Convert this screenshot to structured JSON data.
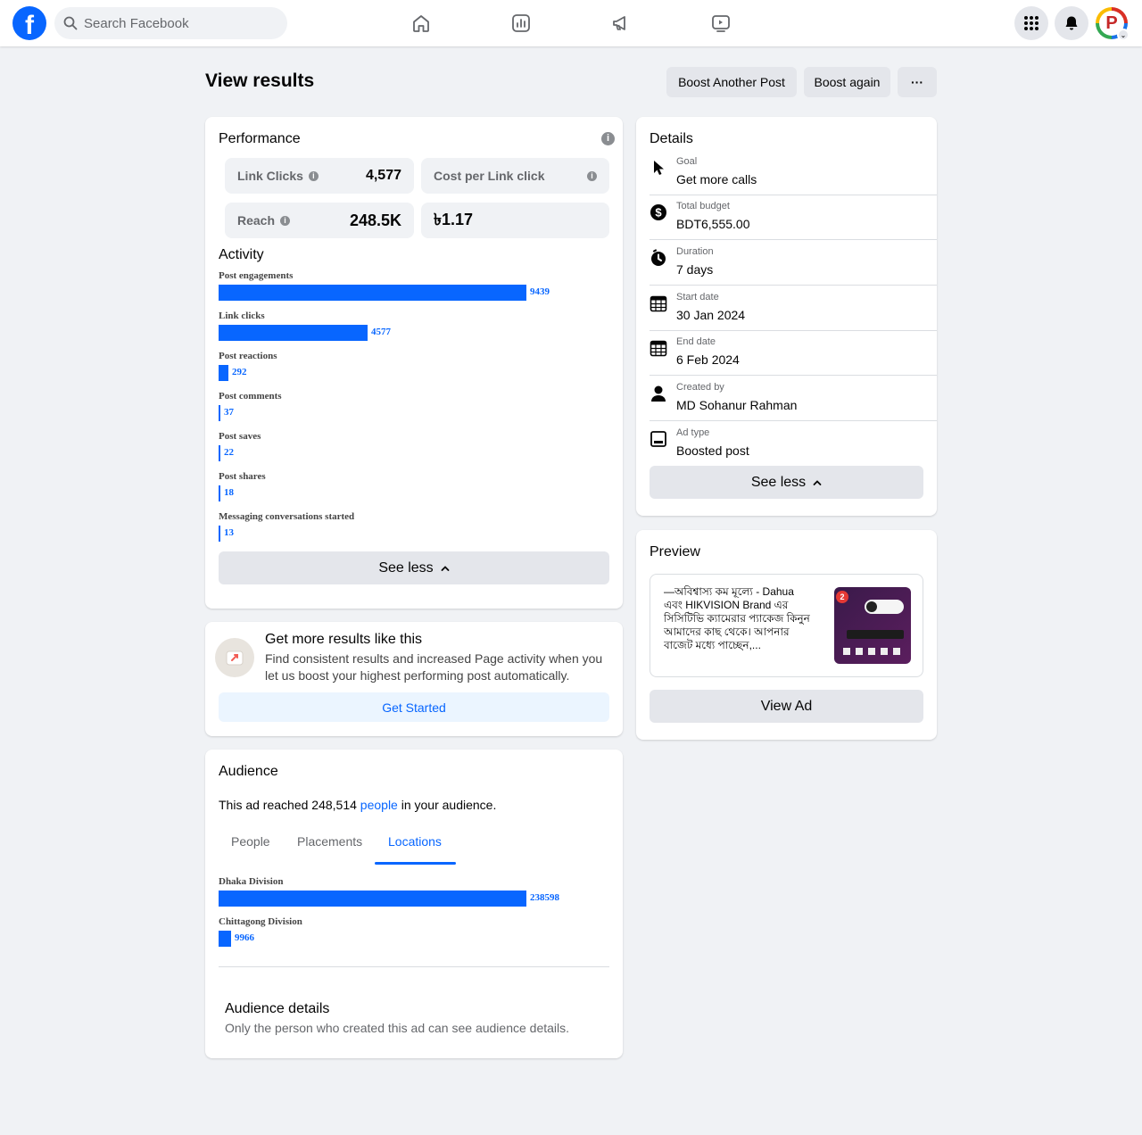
{
  "topbar": {
    "logo_letter": "f",
    "search_placeholder": "Search Facebook",
    "nav_icons": [
      "home-icon",
      "professional-dashboard-icon",
      "ad-center-icon",
      "video-icon"
    ],
    "right_icons": [
      "menu-grid-icon",
      "notifications-icon"
    ],
    "avatar_letter": "P",
    "avatar_badge": "⌄"
  },
  "header": {
    "title": "View results",
    "boost_another": "Boost Another Post",
    "boost_again": "Boost again",
    "more": "···"
  },
  "performance": {
    "title": "Performance",
    "metrics": [
      {
        "label": "Link Clicks",
        "value": "4,577"
      },
      {
        "label": "Cost per Link click",
        "value": ""
      },
      {
        "label": "Reach",
        "value": "248.5K"
      },
      {
        "label": "",
        "value": "৳1.17"
      }
    ],
    "activity_title": "Activity",
    "activity": [
      {
        "label": "Post engagements",
        "value": 9439
      },
      {
        "label": "Link clicks",
        "value": 4577
      },
      {
        "label": "Post reactions",
        "value": 292
      },
      {
        "label": "Post comments",
        "value": 37
      },
      {
        "label": "Post saves",
        "value": 22
      },
      {
        "label": "Post shares",
        "value": 18
      },
      {
        "label": "Messaging conversations started",
        "value": 13
      }
    ],
    "activity_max": 9439,
    "see_less": "See less"
  },
  "promo": {
    "title": "Get more results like this",
    "body": "Find consistent results and increased Page activity when you let us boost your highest performing post automatically.",
    "cta": "Get Started"
  },
  "audience": {
    "title": "Audience",
    "reach_prefix": "This ad reached ",
    "reach_count": "248,514",
    "reach_link": "people",
    "reach_suffix": " in your audience.",
    "tabs": [
      "People",
      "Placements",
      "Locations"
    ],
    "active_tab": "Locations",
    "locations": [
      {
        "label": "Dhaka Division",
        "value": 238598
      },
      {
        "label": "Chittagong Division",
        "value": 9966
      }
    ],
    "locations_max": 238598,
    "details_title": "Audience details",
    "details_body": "Only the person who created this ad can see audience details."
  },
  "details": {
    "title": "Details",
    "rows": [
      {
        "icon": "cursor-icon",
        "key": "Goal",
        "value": "Get more calls"
      },
      {
        "icon": "dollar-icon",
        "key": "Total budget",
        "value": "BDT6,555.00"
      },
      {
        "icon": "stopwatch-icon",
        "key": "Duration",
        "value": "7 days"
      },
      {
        "icon": "calendar-icon",
        "key": "Start date",
        "value": "30 Jan 2024"
      },
      {
        "icon": "calendar-icon",
        "key": "End date",
        "value": "6 Feb 2024"
      },
      {
        "icon": "person-icon",
        "key": "Created by",
        "value": "MD Sohanur Rahman"
      },
      {
        "icon": "ad-type-icon",
        "key": "Ad type",
        "value": "Boosted post"
      }
    ],
    "see_less": "See less"
  },
  "preview": {
    "title": "Preview",
    "text": "—অবিশ্বাস্য কম মূল্যে - Dahua এবং HIKVISION Brand এর সিসিটিভি ক্যামেরার প্যাকেজ কিনুন আমাদের কাছ থেকে। আপনার বাজেট মধ্যে পাচ্ছেন,...",
    "thumb_badge": "2",
    "view_ad": "View Ad"
  },
  "colors": {
    "brand": "#0866ff",
    "background": "#f0f2f5",
    "button_gray": "#e4e6eb"
  }
}
